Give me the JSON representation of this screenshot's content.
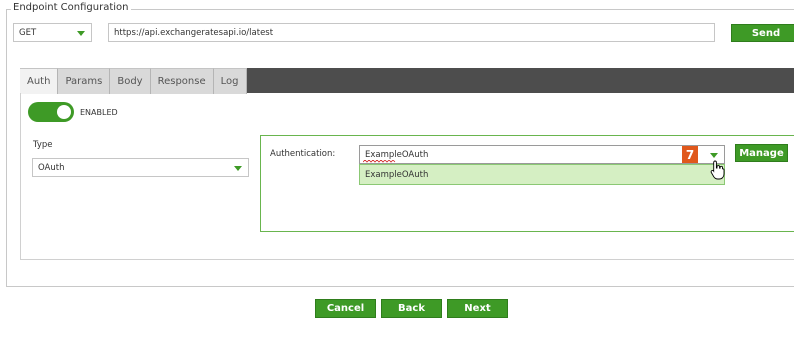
{
  "section": {
    "title": "Endpoint Configuration"
  },
  "request": {
    "method": "GET",
    "url": "https://api.exchangeratesapi.io/latest",
    "send_label": "Send"
  },
  "tabs": [
    {
      "label": "Auth",
      "active": true
    },
    {
      "label": "Params",
      "active": false
    },
    {
      "label": "Body",
      "active": false
    },
    {
      "label": "Response",
      "active": false
    },
    {
      "label": "Log",
      "active": false
    }
  ],
  "auth": {
    "enabled_label": "ENABLED",
    "enabled": true,
    "type_label": "Type",
    "type_value": "OAuth",
    "authentication_label": "Authentication:",
    "authentication_value": "ExampleOAuth",
    "options": [
      "ExampleOAuth"
    ],
    "manage_label": "Manage",
    "step_badge": "7"
  },
  "footer": {
    "cancel_label": "Cancel",
    "back_label": "Back",
    "next_label": "Next"
  },
  "colors": {
    "accent": "#3e9a26",
    "badge": "#e0581c",
    "tabbar": "#4d4d4d",
    "dropdown_highlight": "#d5efc3"
  }
}
